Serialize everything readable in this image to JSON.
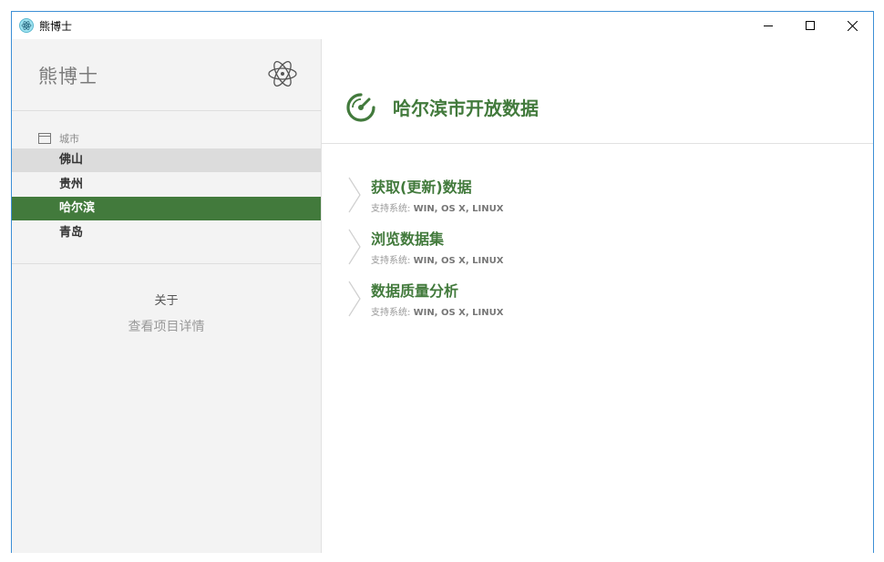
{
  "window": {
    "title": "熊博士",
    "controls": [
      "minimize",
      "maximize",
      "close"
    ]
  },
  "sidebar": {
    "brand": "熊博士",
    "section_label": "城市",
    "items": [
      {
        "label": "佛山",
        "state": "hover"
      },
      {
        "label": "贵州",
        "state": "normal"
      },
      {
        "label": "哈尔滨",
        "state": "active"
      },
      {
        "label": "青岛",
        "state": "normal"
      }
    ],
    "about_title": "关于",
    "about_link": "查看项目详情"
  },
  "main": {
    "title": "哈尔滨市开放数据",
    "actions": [
      {
        "title": "获取(更新)数据",
        "sub_label": "支持系统: ",
        "sub_value": "WIN, OS X, LINUX"
      },
      {
        "title": "浏览数据集",
        "sub_label": "支持系统: ",
        "sub_value": "WIN, OS X, LINUX"
      },
      {
        "title": "数据质量分析",
        "sub_label": "支持系统: ",
        "sub_value": "WIN, OS X, LINUX"
      }
    ]
  },
  "colors": {
    "accent": "#427a3c",
    "window_border": "#3c8fd6",
    "sidebar_bg": "#f3f3f3",
    "hover_bg": "#dcdcdc"
  },
  "icons": {
    "app": "electron-icon",
    "brand": "atom-icon",
    "section": "window-icon",
    "header": "gauge-icon",
    "action": "chevron-right-icon"
  }
}
